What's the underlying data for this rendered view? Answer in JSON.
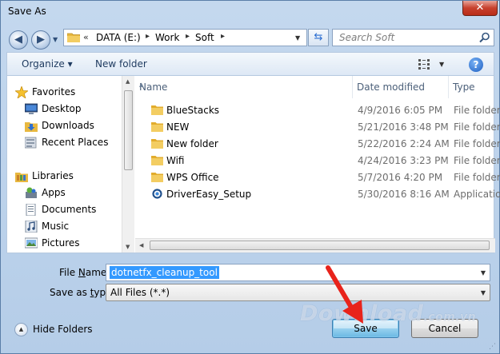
{
  "window": {
    "title": "Save As",
    "close_label": "✕"
  },
  "nav": {
    "back_glyph": "◀",
    "forward_glyph": "▶",
    "address_prefix": "«",
    "breadcrumbs": [
      "DATA (E:)",
      "Work",
      "Soft"
    ],
    "separator": "▸",
    "search_placeholder": "Search Soft"
  },
  "toolbar": {
    "organize_label": "Organize ▾",
    "new_folder_label": "New folder",
    "help_label": "?"
  },
  "sidebar": {
    "items": [
      {
        "label": "Favorites",
        "icon": "star-icon"
      },
      {
        "label": "Desktop",
        "icon": "desktop-icon"
      },
      {
        "label": "Downloads",
        "icon": "downloads-icon"
      },
      {
        "label": "Recent Places",
        "icon": "recent-places-icon"
      },
      {
        "label": "Libraries",
        "icon": "libraries-icon"
      },
      {
        "label": "Apps",
        "icon": "apps-icon"
      },
      {
        "label": "Documents",
        "icon": "documents-icon"
      },
      {
        "label": "Music",
        "icon": "music-icon"
      },
      {
        "label": "Pictures",
        "icon": "pictures-icon"
      }
    ]
  },
  "files": {
    "columns": [
      "Name",
      "Date modified",
      "Type"
    ],
    "rows": [
      {
        "name": "BlueStacks",
        "date": "4/9/2016 6:05 PM",
        "type": "File folder",
        "icon": "folder-icon"
      },
      {
        "name": "NEW",
        "date": "5/21/2016 3:48 PM",
        "type": "File folder",
        "icon": "folder-icon"
      },
      {
        "name": "New folder",
        "date": "5/22/2016 2:24 AM",
        "type": "File folder",
        "icon": "folder-icon"
      },
      {
        "name": "Wifi",
        "date": "4/24/2016 3:23 PM",
        "type": "File folder",
        "icon": "folder-icon"
      },
      {
        "name": "WPS Office",
        "date": "5/7/2016 4:20 PM",
        "type": "File folder",
        "icon": "folder-icon"
      },
      {
        "name": "DriverEasy_Setup",
        "date": "5/30/2016 8:16 AM",
        "type": "Application",
        "icon": "application-icon"
      }
    ]
  },
  "form": {
    "file_name_label_u": "N",
    "file_name_label_rest": "ame:",
    "file_name_label_pre": "File ",
    "file_name_value": "dotnetfx_cleanup_tool",
    "save_type_label_pre": "Save as ",
    "save_type_label_u": "t",
    "save_type_label_rest": "ype:",
    "save_type_value": "All Files (*.*)"
  },
  "footer": {
    "hide_folders_label": "Hide Folders",
    "save_label": "Save",
    "cancel_label": "Cancel"
  },
  "watermark": {
    "brand": "Download",
    "domain": ".com.vn"
  },
  "colors": {
    "accent": "#3399ff",
    "folder": "#e8b840",
    "arrow": "#e8231b",
    "titlebar": "#c4d8ee"
  }
}
